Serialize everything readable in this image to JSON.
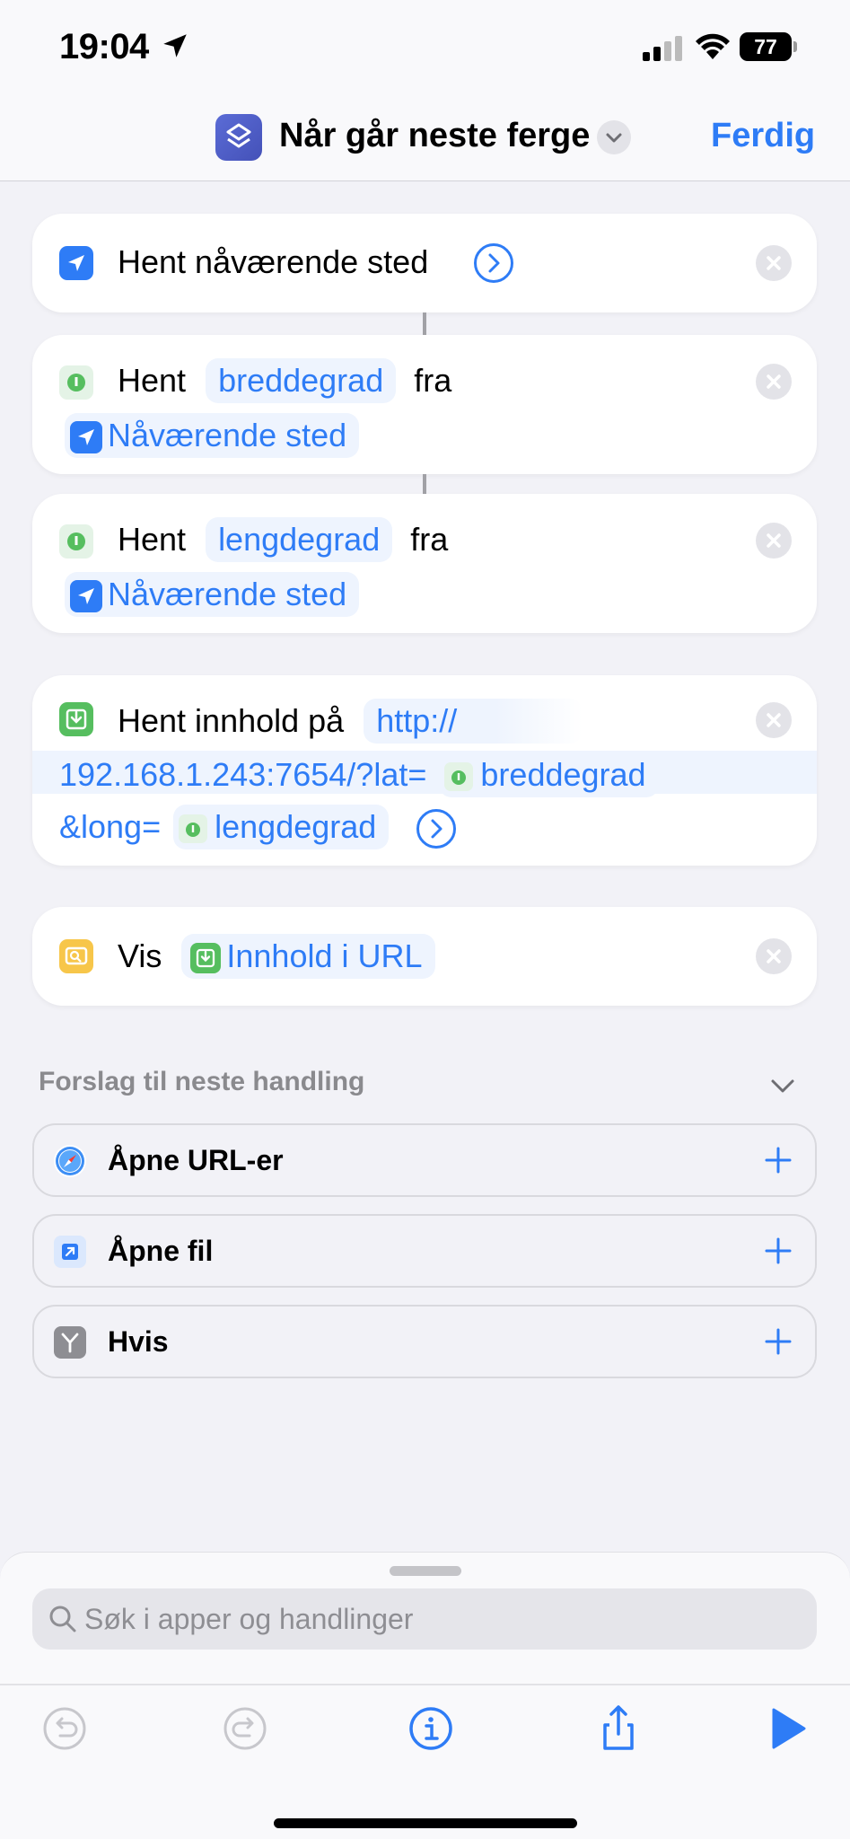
{
  "status_bar": {
    "time": "19:04",
    "battery": "77"
  },
  "nav": {
    "title": "Når går neste ferge",
    "done_label": "Ferdig"
  },
  "actions": [
    {
      "label": "Hent nåværende sted"
    },
    {
      "verb": "Hent",
      "param": "breddegrad",
      "prep": "fra",
      "source": "Nåværende sted"
    },
    {
      "verb": "Hent",
      "param": "lengdegrad",
      "prep": "fra",
      "source": "Nåværende sted"
    },
    {
      "label": "Hent innhold på",
      "url_part1": "http://",
      "url_part2": "192.168.1.243:7654/?lat=",
      "var1": "breddegrad",
      "url_part3": "&long=",
      "var2": "lengdegrad"
    },
    {
      "verb": "Vis",
      "var": "Innhold i URL"
    }
  ],
  "suggestions": {
    "header": "Forslag til neste handling",
    "items": [
      {
        "label": "Åpne URL-er"
      },
      {
        "label": "Åpne fil"
      },
      {
        "label": "Hvis"
      }
    ]
  },
  "search": {
    "placeholder": "Søk i apper og handlinger"
  },
  "colors": {
    "accent": "#2e7cf6",
    "green": "#56be5f",
    "yellow": "#f7c64a"
  }
}
